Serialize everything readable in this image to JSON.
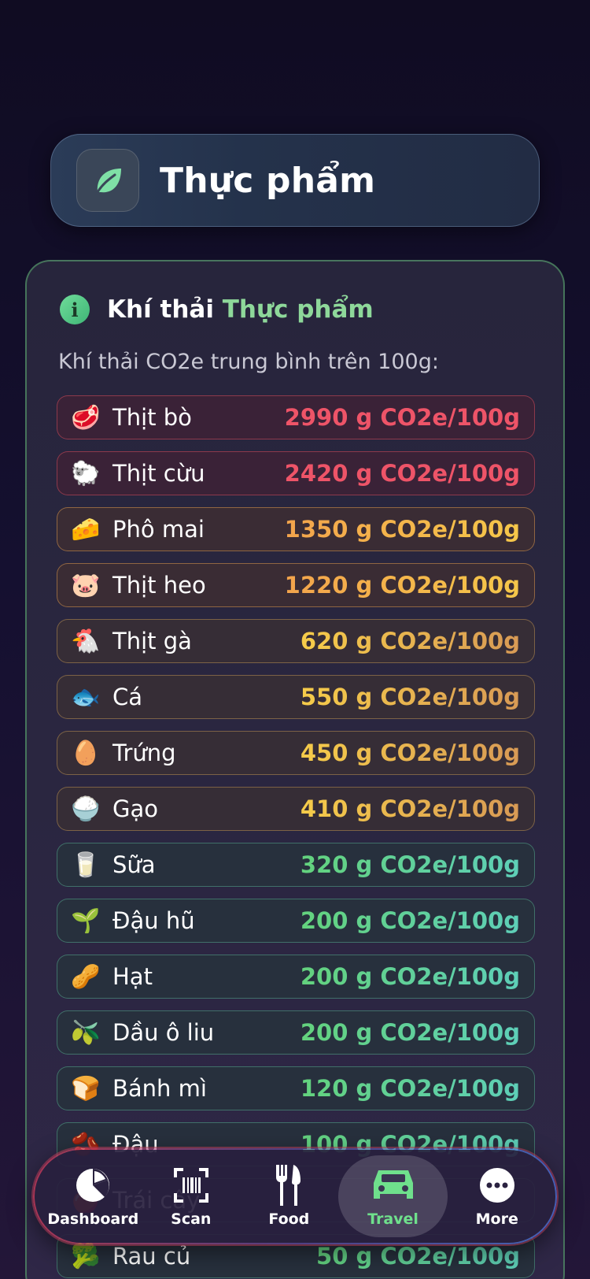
{
  "header": {
    "title": "Thực phẩm",
    "icon": "leaf-icon"
  },
  "info": {
    "title_prefix": "Khí thải ",
    "title_accent": "Thực phẩm",
    "subtitle": "Khí thải CO2e trung bình trên 100g:"
  },
  "foods": [
    {
      "emoji": "🥩",
      "name": "Thịt bò",
      "value": "2990 g CO2e/100g",
      "level": "red"
    },
    {
      "emoji": "🐑",
      "name": "Thịt cừu",
      "value": "2420 g CO2e/100g",
      "level": "red"
    },
    {
      "emoji": "🧀",
      "name": "Phô mai",
      "value": "1350 g CO2e/100g",
      "level": "orange"
    },
    {
      "emoji": "🐷",
      "name": "Thịt heo",
      "value": "1220 g CO2e/100g",
      "level": "orange"
    },
    {
      "emoji": "🐔",
      "name": "Thịt gà",
      "value": "620 g CO2e/100g",
      "level": "yellow"
    },
    {
      "emoji": "🐟",
      "name": "Cá",
      "value": "550 g CO2e/100g",
      "level": "yellow"
    },
    {
      "emoji": "🥚",
      "name": "Trứng",
      "value": "450 g CO2e/100g",
      "level": "yellow"
    },
    {
      "emoji": "🍚",
      "name": "Gạo",
      "value": "410 g CO2e/100g",
      "level": "yellow"
    },
    {
      "emoji": "🥛",
      "name": "Sữa",
      "value": "320 g CO2e/100g",
      "level": "green"
    },
    {
      "emoji": "🌱",
      "name": "Đậu hũ",
      "value": "200 g CO2e/100g",
      "level": "green"
    },
    {
      "emoji": "🥜",
      "name": "Hạt",
      "value": "200 g CO2e/100g",
      "level": "green"
    },
    {
      "emoji": "🫒",
      "name": "Dầu ô liu",
      "value": "200 g CO2e/100g",
      "level": "green"
    },
    {
      "emoji": "🍞",
      "name": "Bánh mì",
      "value": "120 g CO2e/100g",
      "level": "green"
    },
    {
      "emoji": "🫘",
      "name": "Đậu",
      "value": "100 g CO2e/100g",
      "level": "green"
    },
    {
      "emoji": "🍎",
      "name": "Trái cây",
      "value": "",
      "level": "green"
    },
    {
      "emoji": "🥦",
      "name": "Rau củ",
      "value": "50 g CO2e/100g",
      "level": "green"
    }
  ],
  "tabs": [
    {
      "label": "Dashboard",
      "icon": "pie-chart-icon",
      "active": false
    },
    {
      "label": "Scan",
      "icon": "barcode-scan-icon",
      "active": false
    },
    {
      "label": "Food",
      "icon": "fork-knife-icon",
      "active": false
    },
    {
      "label": "Travel",
      "icon": "car-icon",
      "active": true
    },
    {
      "label": "More",
      "icon": "more-dots-icon",
      "active": false
    }
  ],
  "colors": {
    "accent_green": "#6fe08c",
    "high": "#ee5468",
    "medium": "#f5c74a",
    "low": "#63d27d"
  }
}
